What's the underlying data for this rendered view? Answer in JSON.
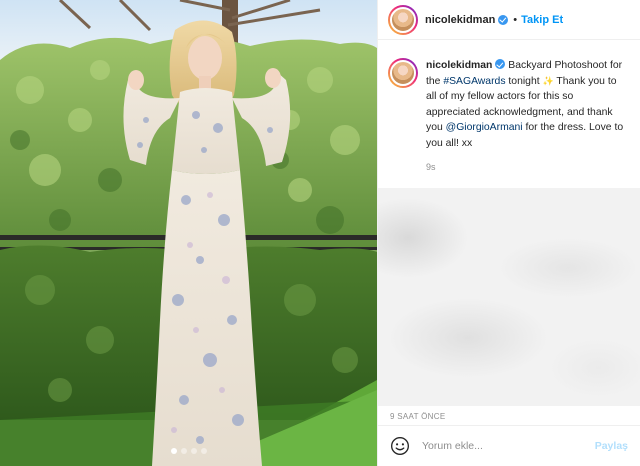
{
  "post": {
    "author": {
      "username": "nicolekidman",
      "verified": true,
      "follow_label": "Takip Et",
      "separator": "•"
    },
    "caption": {
      "username": "nicolekidman",
      "text_part1": "Backyard Photoshoot for the ",
      "hashtag": "#SAGAwards",
      "text_part2": " tonight ",
      "sparkle": "✨",
      "text_part3": " Thank you to all of my fellow actors for this so appreciated acknowledgment, and thank you ",
      "mention": "@GiorgioArmani",
      "text_part4": " for the dress. Love to you all! xx",
      "time_ago": "9s"
    },
    "timestamp": "9 SAAT ÖNCE",
    "comment_box": {
      "placeholder": "Yorum ekle...",
      "post_label": "Paylaş"
    },
    "colors": {
      "link_blue": "#0095f6",
      "verified_blue": "#3897f0",
      "muted_text": "#8e8e8e",
      "post_disabled": "#b2dffc"
    }
  }
}
